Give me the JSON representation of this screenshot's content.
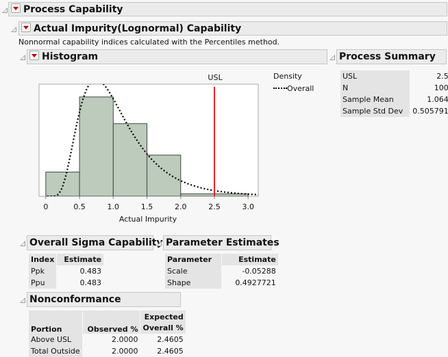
{
  "report": {
    "title": "Process Capability",
    "subtitle": "Actual Impurity(Lognormal) Capability",
    "note": "Nonnormal capability indices calculated with the Percentiles method."
  },
  "histogram": {
    "title": "Histogram",
    "legend_title": "Density",
    "legend_item": "Overall",
    "usl_label": "USL"
  },
  "chart_data": {
    "type": "bar",
    "xlabel": "Actual Impurity",
    "xlim": [
      -0.1,
      3.15
    ],
    "ylim": [
      0,
      46.3
    ],
    "bins": [
      [
        0,
        0.5
      ],
      [
        0.5,
        1.0
      ],
      [
        1.0,
        1.5
      ],
      [
        1.5,
        2.0
      ],
      [
        2.0,
        3.0
      ]
    ],
    "counts": [
      10,
      41,
      30,
      17,
      2
    ],
    "xticks": [
      "0",
      "0.5",
      "1.0",
      "1.5",
      "2.0",
      "2.5",
      "3.0"
    ],
    "usl": 2.5,
    "usl_color": "#e8202a",
    "bar_color": "#bccbbc",
    "density": {
      "name": "Overall",
      "distribution": "lognormal",
      "scale": -0.05288,
      "shape": 0.4927721,
      "n": 100,
      "style": "dotted"
    }
  },
  "process_summary": {
    "title": "Process Summary",
    "rows": [
      [
        "USL",
        "2.5"
      ],
      [
        "N",
        "100"
      ],
      [
        "Sample Mean",
        "1.064"
      ],
      [
        "Sample Std Dev",
        "0.505791"
      ]
    ]
  },
  "overall_sigma": {
    "title": "Overall Sigma Capability",
    "headers": [
      "Index",
      "Estimate"
    ],
    "rows": [
      [
        "Ppk",
        "0.483"
      ],
      [
        "Ppu",
        "0.483"
      ]
    ]
  },
  "parameter_estimates": {
    "title": "Parameter Estimates",
    "headers": [
      "Parameter",
      "Estimate"
    ],
    "rows": [
      [
        "Scale",
        "-0.05288"
      ],
      [
        "Shape",
        "0.4927721"
      ]
    ]
  },
  "nonconformance": {
    "title": "Nonconformance",
    "headers": [
      "Portion",
      "Observed %",
      "Expected",
      "Overall %"
    ],
    "rows": [
      [
        "Above USL",
        "2.0000",
        "2.4605"
      ],
      [
        "Total Outside",
        "2.0000",
        "2.4605"
      ]
    ]
  }
}
